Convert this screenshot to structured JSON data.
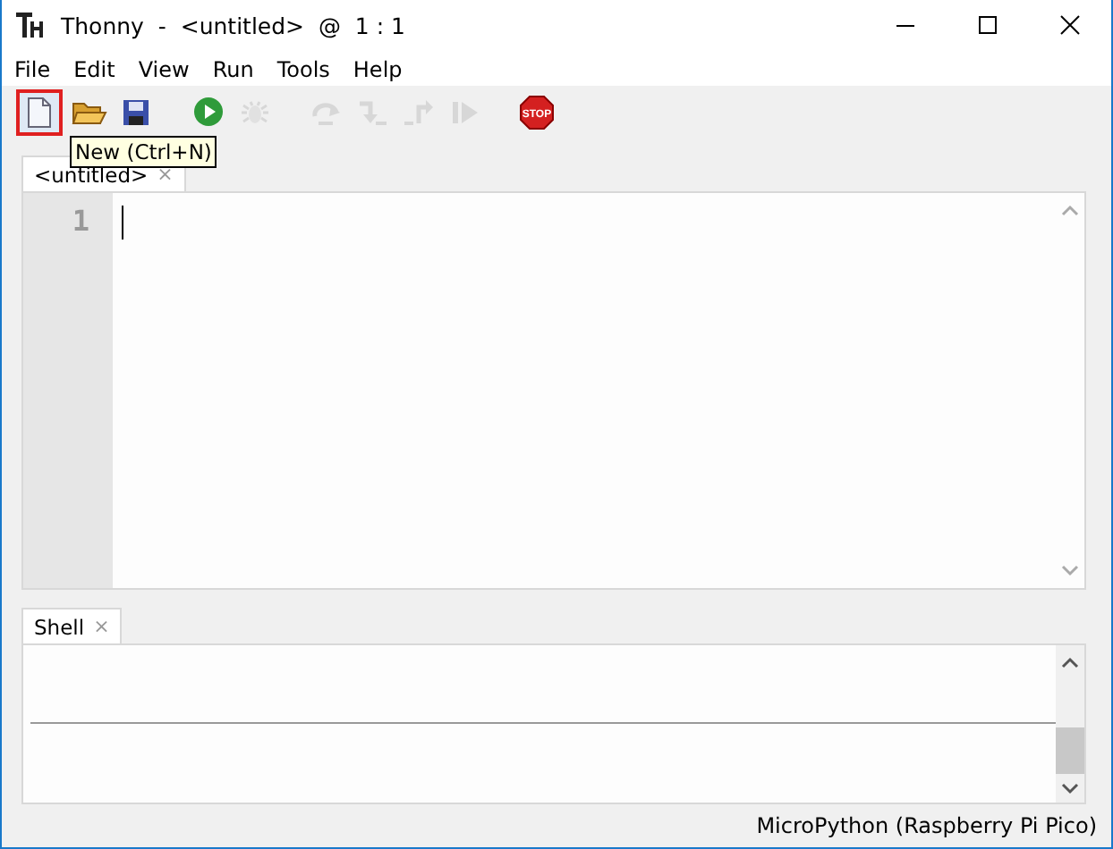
{
  "window": {
    "title": "Thonny  -  <untitled>  @  1 : 1"
  },
  "menu": [
    "File",
    "Edit",
    "View",
    "Run",
    "Tools",
    "Help"
  ],
  "toolbar": [
    {
      "kind": "new",
      "disabled": false,
      "highlighted": true
    },
    {
      "kind": "open",
      "disabled": false,
      "highlighted": false
    },
    {
      "kind": "save",
      "disabled": false,
      "highlighted": false
    },
    {
      "kind": "separator"
    },
    {
      "kind": "run",
      "disabled": false,
      "highlighted": false
    },
    {
      "kind": "debug",
      "disabled": true,
      "highlighted": false
    },
    {
      "kind": "separator"
    },
    {
      "kind": "step-over",
      "disabled": true,
      "highlighted": false
    },
    {
      "kind": "step-into",
      "disabled": true,
      "highlighted": false
    },
    {
      "kind": "step-out",
      "disabled": true,
      "highlighted": false
    },
    {
      "kind": "resume",
      "disabled": true,
      "highlighted": false
    },
    {
      "kind": "separator"
    },
    {
      "kind": "stop",
      "disabled": false,
      "highlighted": false,
      "label": "STOP"
    }
  ],
  "tooltip": "New (Ctrl+N)",
  "editor": {
    "tab": "<untitled>",
    "close": "×",
    "line_numbers": [
      "1"
    ]
  },
  "shell": {
    "tab": "Shell",
    "close": "×"
  },
  "status_bar": "MicroPython (Raspberry Pi Pico)"
}
